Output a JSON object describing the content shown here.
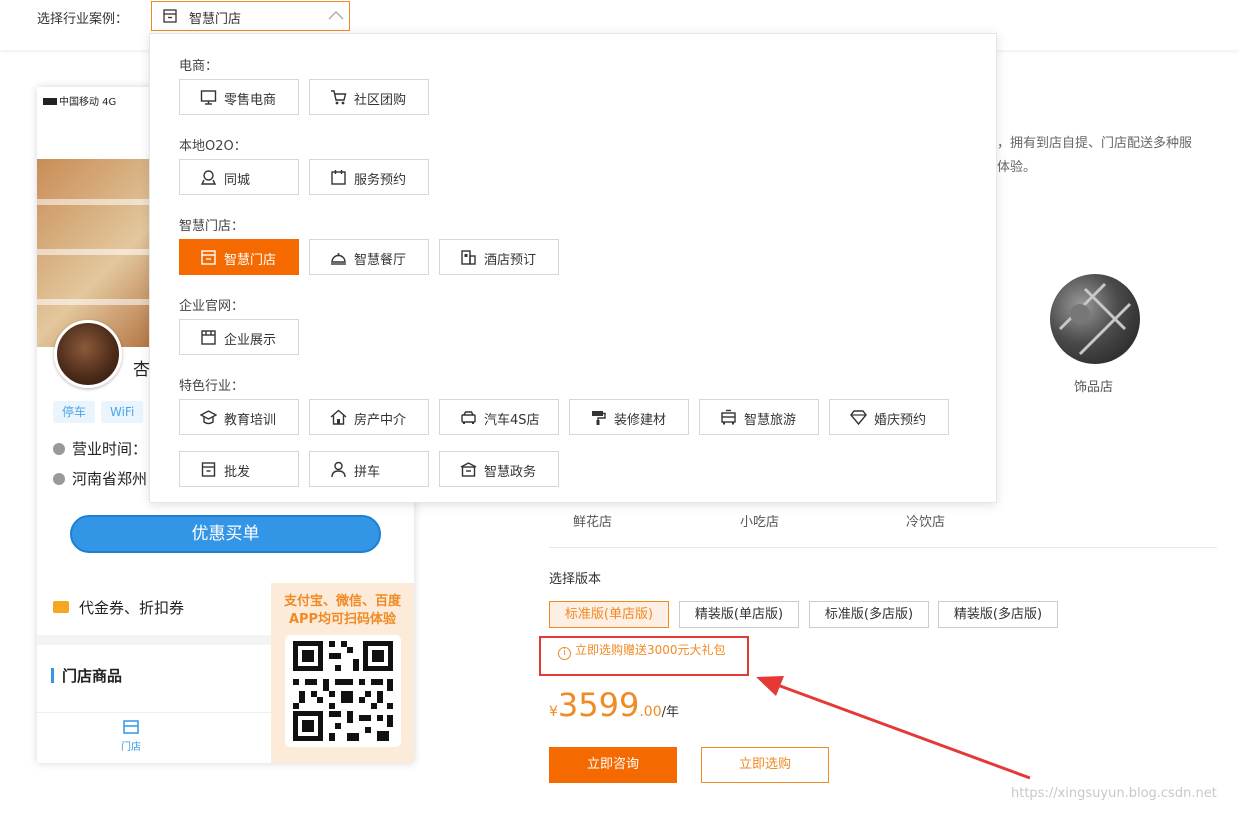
{
  "selector": {
    "label": "选择行业案例：",
    "current": "智慧门店"
  },
  "dropdown": {
    "categories": [
      {
        "title": "电商：",
        "options": [
          "零售电商",
          "社区团购"
        ]
      },
      {
        "title": "本地O2O：",
        "options": [
          "同城",
          "服务预约"
        ]
      },
      {
        "title": "智慧门店：",
        "options": [
          "智慧门店",
          "智慧餐厅",
          "酒店预订"
        ],
        "active": "智慧门店"
      },
      {
        "title": "企业官网：",
        "options": [
          "企业展示"
        ]
      },
      {
        "title": "特色行业：",
        "options": [
          "教育培训",
          "房产中介",
          "汽车4S店",
          "装修建材",
          "智慧旅游",
          "婚庆预约",
          "批发",
          "拼车",
          "智慧政务"
        ]
      }
    ]
  },
  "phone": {
    "status_bar": "中国移动  4G",
    "store_name_partial": "杏",
    "tags": [
      "停车",
      "WiFi"
    ],
    "hours": "营业时间：",
    "address": "河南省郑州",
    "pay_button": "优惠买单",
    "coupon": "代金券、折扣券",
    "goods_title": "门店商品",
    "tab_store": "门店",
    "qr_text": [
      "支付宝、微信、百度",
      "APP均可扫码体验"
    ]
  },
  "right": {
    "intro_lines": [
      "，拥有到店自提、门店配送多种服",
      "体验。"
    ],
    "round_label": "饰品店",
    "store_types": [
      "鲜花店",
      "小吃店",
      "冷饮店"
    ],
    "version_label": "选择版本",
    "versions": [
      "标准版(单店版)",
      "精装版(单店版)",
      "标准版(多店版)",
      "精装版(多店版)"
    ],
    "active_version": "标准版(单店版)",
    "gift": "立即选购赠送3000元大礼包",
    "price": {
      "currency": "¥",
      "integer": "3599",
      "decimal": ".00",
      "unit": "/年"
    },
    "consult_button": "立即咨询",
    "choose_button": "立即选购"
  },
  "watermark": "https://xingsuyun.blog.csdn.net",
  "colors": {
    "accent": "#f56a00",
    "accent_soft": "#fdefe3",
    "blue": "#3295e6",
    "annotation_red": "#e53935"
  },
  "icons": {
    "零售电商": "monitor-icon",
    "社区团购": "cart-icon",
    "同城": "location-icon",
    "服务预约": "calendar-icon",
    "智慧门店": "store-icon",
    "智慧餐厅": "dish-icon",
    "酒店预订": "hotel-icon",
    "企业展示": "company-icon",
    "教育培训": "graduation-cap-icon",
    "房产中介": "house-icon",
    "汽车4S店": "car-icon",
    "装修建材": "paint-roller-icon",
    "智慧旅游": "bus-icon",
    "婚庆预约": "diamond-icon",
    "批发": "box-icon",
    "拼车": "person-icon",
    "智慧政务": "government-icon"
  }
}
